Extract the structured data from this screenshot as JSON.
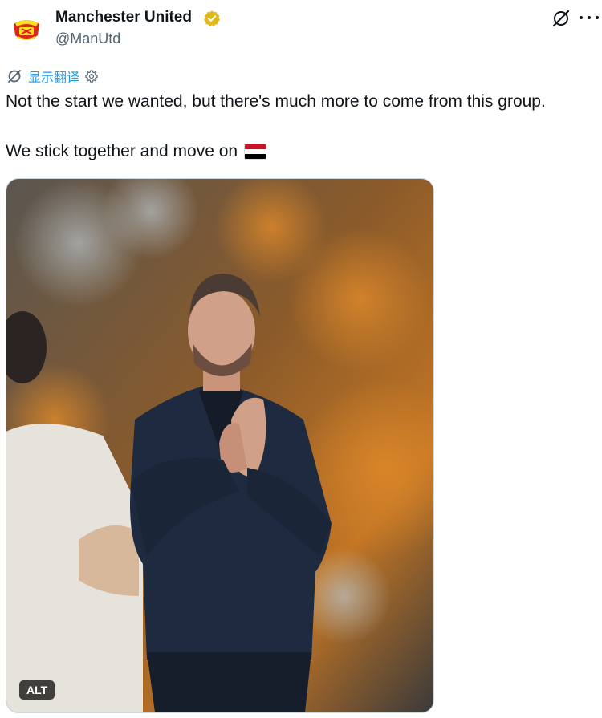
{
  "account": {
    "name": "Manchester United",
    "handle": "@ManUtd",
    "verified": true,
    "verified_badge_color": "#e2b719"
  },
  "actions": {
    "grok_icon": "grok-icon",
    "more_icon": "more-dots-icon"
  },
  "translate": {
    "label": "显示翻译",
    "icon": "translate-icon",
    "settings_icon": "gear-icon",
    "color": "#1d9bf0"
  },
  "post": {
    "line1": "Not the start we wanted, but there's much more to come from this group.",
    "line2": "We stick together and move on",
    "line2_emoji": "flag-red-white-black"
  },
  "media": {
    "alt_label": "ALT",
    "description_icon": "photo"
  }
}
